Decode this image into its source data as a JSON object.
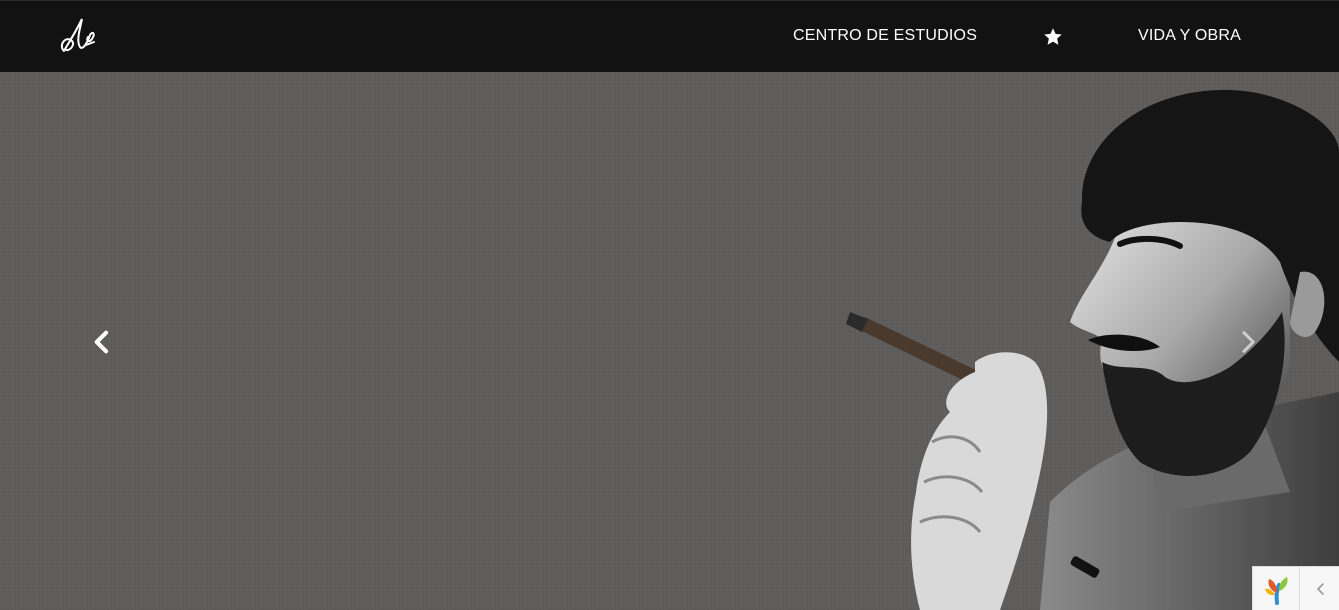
{
  "navbar": {
    "logo_icon": "signature-logo-icon",
    "links": {
      "centro": "CENTRO DE ESTUDIOS",
      "star_icon": "star-icon",
      "vida": "VIDA Y OBRA"
    }
  },
  "hero": {
    "image": "portrait-photo",
    "prev_icon": "chevron-left-icon",
    "next_icon": "chevron-right-icon"
  },
  "widget": {
    "logo_icon": "framework-logo-icon",
    "toggle_icon": "chevron-left-icon"
  },
  "colors": {
    "navbar_bg": "#121212",
    "hero_bg": "#5e5c5a",
    "text": "#ffffff"
  }
}
